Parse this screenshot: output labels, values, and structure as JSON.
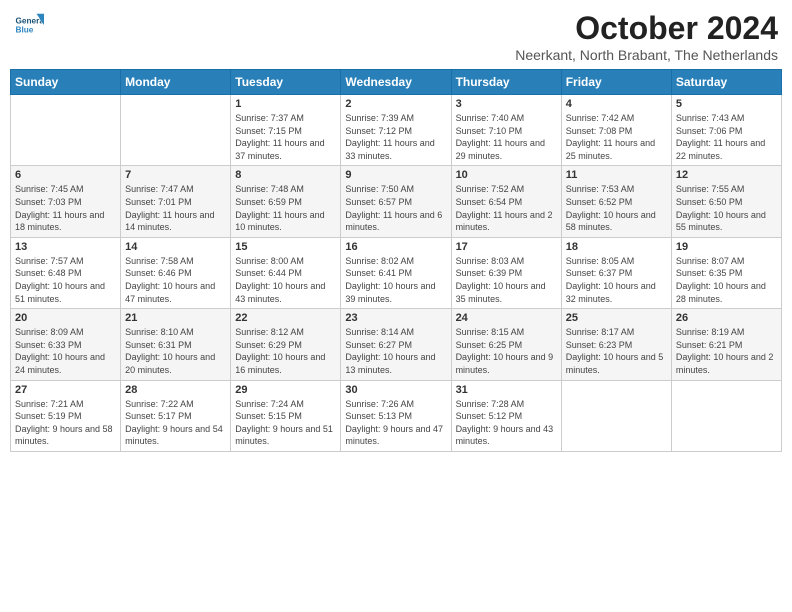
{
  "header": {
    "logo_general": "General",
    "logo_blue": "Blue",
    "month_title": "October 2024",
    "subtitle": "Neerkant, North Brabant, The Netherlands"
  },
  "weekdays": [
    "Sunday",
    "Monday",
    "Tuesday",
    "Wednesday",
    "Thursday",
    "Friday",
    "Saturday"
  ],
  "weeks": [
    [
      {
        "day": "",
        "sunrise": "",
        "sunset": "",
        "daylight": ""
      },
      {
        "day": "",
        "sunrise": "",
        "sunset": "",
        "daylight": ""
      },
      {
        "day": "1",
        "sunrise": "Sunrise: 7:37 AM",
        "sunset": "Sunset: 7:15 PM",
        "daylight": "Daylight: 11 hours and 37 minutes."
      },
      {
        "day": "2",
        "sunrise": "Sunrise: 7:39 AM",
        "sunset": "Sunset: 7:12 PM",
        "daylight": "Daylight: 11 hours and 33 minutes."
      },
      {
        "day": "3",
        "sunrise": "Sunrise: 7:40 AM",
        "sunset": "Sunset: 7:10 PM",
        "daylight": "Daylight: 11 hours and 29 minutes."
      },
      {
        "day": "4",
        "sunrise": "Sunrise: 7:42 AM",
        "sunset": "Sunset: 7:08 PM",
        "daylight": "Daylight: 11 hours and 25 minutes."
      },
      {
        "day": "5",
        "sunrise": "Sunrise: 7:43 AM",
        "sunset": "Sunset: 7:06 PM",
        "daylight": "Daylight: 11 hours and 22 minutes."
      }
    ],
    [
      {
        "day": "6",
        "sunrise": "Sunrise: 7:45 AM",
        "sunset": "Sunset: 7:03 PM",
        "daylight": "Daylight: 11 hours and 18 minutes."
      },
      {
        "day": "7",
        "sunrise": "Sunrise: 7:47 AM",
        "sunset": "Sunset: 7:01 PM",
        "daylight": "Daylight: 11 hours and 14 minutes."
      },
      {
        "day": "8",
        "sunrise": "Sunrise: 7:48 AM",
        "sunset": "Sunset: 6:59 PM",
        "daylight": "Daylight: 11 hours and 10 minutes."
      },
      {
        "day": "9",
        "sunrise": "Sunrise: 7:50 AM",
        "sunset": "Sunset: 6:57 PM",
        "daylight": "Daylight: 11 hours and 6 minutes."
      },
      {
        "day": "10",
        "sunrise": "Sunrise: 7:52 AM",
        "sunset": "Sunset: 6:54 PM",
        "daylight": "Daylight: 11 hours and 2 minutes."
      },
      {
        "day": "11",
        "sunrise": "Sunrise: 7:53 AM",
        "sunset": "Sunset: 6:52 PM",
        "daylight": "Daylight: 10 hours and 58 minutes."
      },
      {
        "day": "12",
        "sunrise": "Sunrise: 7:55 AM",
        "sunset": "Sunset: 6:50 PM",
        "daylight": "Daylight: 10 hours and 55 minutes."
      }
    ],
    [
      {
        "day": "13",
        "sunrise": "Sunrise: 7:57 AM",
        "sunset": "Sunset: 6:48 PM",
        "daylight": "Daylight: 10 hours and 51 minutes."
      },
      {
        "day": "14",
        "sunrise": "Sunrise: 7:58 AM",
        "sunset": "Sunset: 6:46 PM",
        "daylight": "Daylight: 10 hours and 47 minutes."
      },
      {
        "day": "15",
        "sunrise": "Sunrise: 8:00 AM",
        "sunset": "Sunset: 6:44 PM",
        "daylight": "Daylight: 10 hours and 43 minutes."
      },
      {
        "day": "16",
        "sunrise": "Sunrise: 8:02 AM",
        "sunset": "Sunset: 6:41 PM",
        "daylight": "Daylight: 10 hours and 39 minutes."
      },
      {
        "day": "17",
        "sunrise": "Sunrise: 8:03 AM",
        "sunset": "Sunset: 6:39 PM",
        "daylight": "Daylight: 10 hours and 35 minutes."
      },
      {
        "day": "18",
        "sunrise": "Sunrise: 8:05 AM",
        "sunset": "Sunset: 6:37 PM",
        "daylight": "Daylight: 10 hours and 32 minutes."
      },
      {
        "day": "19",
        "sunrise": "Sunrise: 8:07 AM",
        "sunset": "Sunset: 6:35 PM",
        "daylight": "Daylight: 10 hours and 28 minutes."
      }
    ],
    [
      {
        "day": "20",
        "sunrise": "Sunrise: 8:09 AM",
        "sunset": "Sunset: 6:33 PM",
        "daylight": "Daylight: 10 hours and 24 minutes."
      },
      {
        "day": "21",
        "sunrise": "Sunrise: 8:10 AM",
        "sunset": "Sunset: 6:31 PM",
        "daylight": "Daylight: 10 hours and 20 minutes."
      },
      {
        "day": "22",
        "sunrise": "Sunrise: 8:12 AM",
        "sunset": "Sunset: 6:29 PM",
        "daylight": "Daylight: 10 hours and 16 minutes."
      },
      {
        "day": "23",
        "sunrise": "Sunrise: 8:14 AM",
        "sunset": "Sunset: 6:27 PM",
        "daylight": "Daylight: 10 hours and 13 minutes."
      },
      {
        "day": "24",
        "sunrise": "Sunrise: 8:15 AM",
        "sunset": "Sunset: 6:25 PM",
        "daylight": "Daylight: 10 hours and 9 minutes."
      },
      {
        "day": "25",
        "sunrise": "Sunrise: 8:17 AM",
        "sunset": "Sunset: 6:23 PM",
        "daylight": "Daylight: 10 hours and 5 minutes."
      },
      {
        "day": "26",
        "sunrise": "Sunrise: 8:19 AM",
        "sunset": "Sunset: 6:21 PM",
        "daylight": "Daylight: 10 hours and 2 minutes."
      }
    ],
    [
      {
        "day": "27",
        "sunrise": "Sunrise: 7:21 AM",
        "sunset": "Sunset: 5:19 PM",
        "daylight": "Daylight: 9 hours and 58 minutes."
      },
      {
        "day": "28",
        "sunrise": "Sunrise: 7:22 AM",
        "sunset": "Sunset: 5:17 PM",
        "daylight": "Daylight: 9 hours and 54 minutes."
      },
      {
        "day": "29",
        "sunrise": "Sunrise: 7:24 AM",
        "sunset": "Sunset: 5:15 PM",
        "daylight": "Daylight: 9 hours and 51 minutes."
      },
      {
        "day": "30",
        "sunrise": "Sunrise: 7:26 AM",
        "sunset": "Sunset: 5:13 PM",
        "daylight": "Daylight: 9 hours and 47 minutes."
      },
      {
        "day": "31",
        "sunrise": "Sunrise: 7:28 AM",
        "sunset": "Sunset: 5:12 PM",
        "daylight": "Daylight: 9 hours and 43 minutes."
      },
      {
        "day": "",
        "sunrise": "",
        "sunset": "",
        "daylight": ""
      },
      {
        "day": "",
        "sunrise": "",
        "sunset": "",
        "daylight": ""
      }
    ]
  ]
}
